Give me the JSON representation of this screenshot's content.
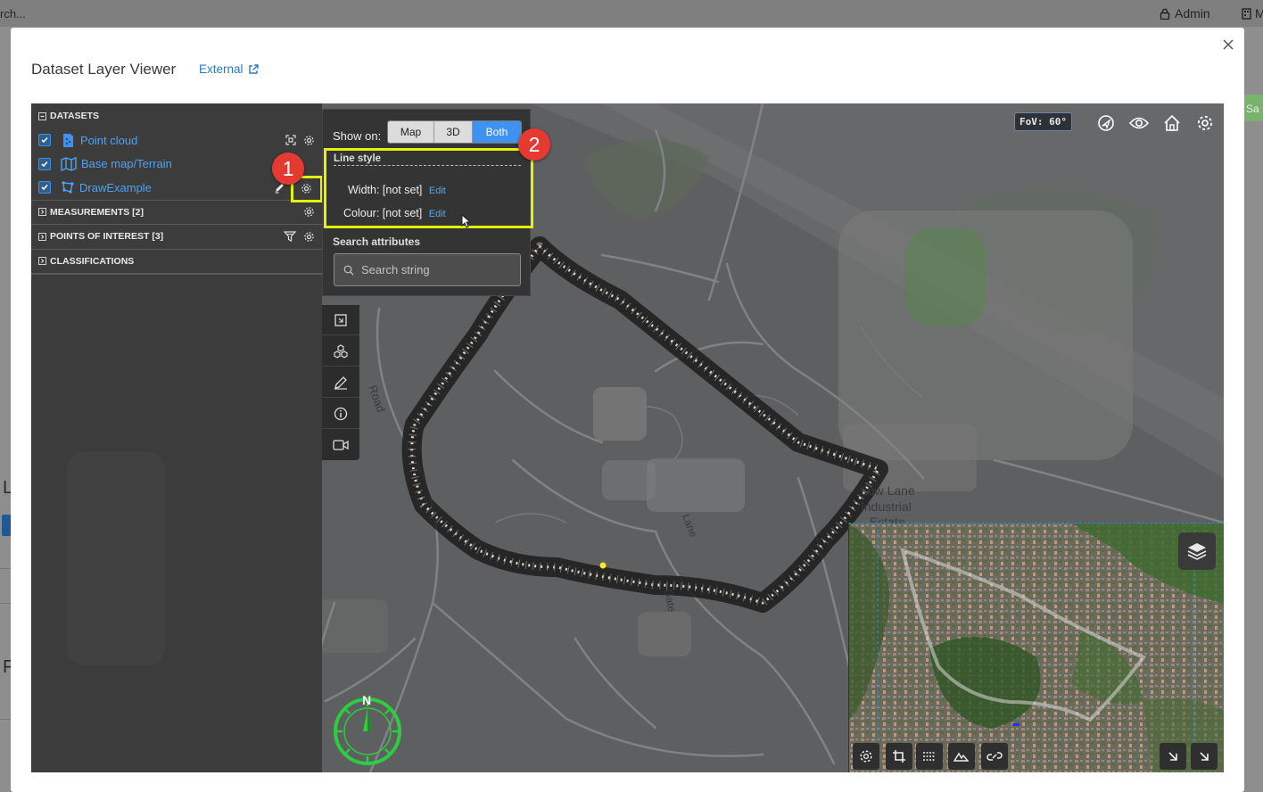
{
  "backdrop": {
    "search_fragment": "rch...",
    "admin_label": "Admin",
    "m_label": "M",
    "side_letter_1": "L",
    "side_letter_2": "F",
    "green_button_fragment": "Sa"
  },
  "modal": {
    "title": "Dataset Layer Viewer",
    "external_label": "External"
  },
  "layer_panel": {
    "datasets_header": "DATASETS",
    "datasets": [
      {
        "label": "Point cloud",
        "checked": true,
        "icon": "point-cloud-icon"
      },
      {
        "label": "Base map/Terrain",
        "checked": true,
        "icon": "map-icon"
      },
      {
        "label": "DrawExample",
        "checked": true,
        "icon": "polygon-draw-icon"
      }
    ],
    "measurements_header": "MEASUREMENTS [2]",
    "poi_header": "POINTS OF INTEREST [3]",
    "classifications_header": "CLASSIFICATIONS"
  },
  "popover": {
    "show_on_label": "Show on:",
    "options": [
      "Map",
      "3D",
      "Both"
    ],
    "selected": "Both",
    "line_style_title": "Line style",
    "width_label": "Width:",
    "width_value": "[not set]",
    "colour_label": "Colour:",
    "colour_value": "[not set]",
    "edit_label": "Edit",
    "search_title": "Search attributes",
    "search_placeholder": "Search string"
  },
  "annotations": {
    "badge_1": "1",
    "badge_2": "2"
  },
  "viewer": {
    "fov_label": "FoV: 60°",
    "compass_letter": "N",
    "map_labels": [
      "Road",
      "Low Lane",
      "Industrial",
      "Estate",
      "Lane",
      "Gate"
    ]
  },
  "colors": {
    "accent_blue": "#3f93f0",
    "highlight_yellow": "#e4f20a",
    "badge_red": "#e43a32",
    "compass_green": "#2ecc40"
  }
}
